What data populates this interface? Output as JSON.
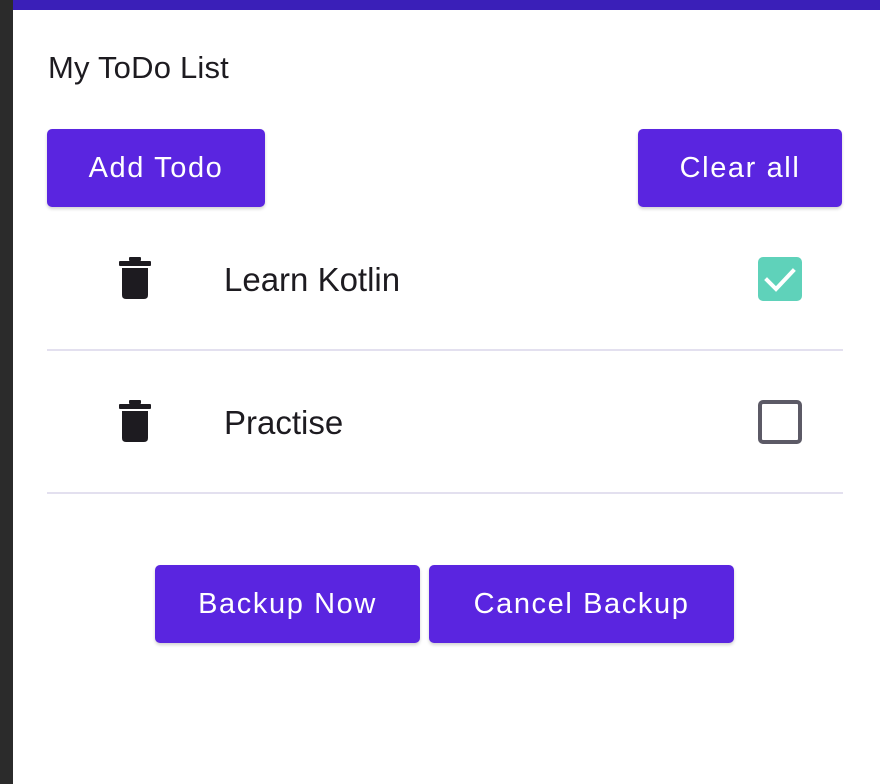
{
  "app": {
    "title": "My ToDo List"
  },
  "toolbar": {
    "add_label": "Add Todo",
    "clear_label": "Clear all"
  },
  "todos": [
    {
      "text": "Learn Kotlin",
      "done": true
    },
    {
      "text": "Practise",
      "done": false
    }
  ],
  "backup": {
    "backup_label": "Backup Now",
    "cancel_label": "Cancel Backup"
  },
  "colors": {
    "accent": "#5a25e0",
    "status_bar": "#3a1fb8",
    "checked": "#5fd2ba",
    "divider": "#e3e0ef"
  },
  "icons": {
    "delete": "trash-icon",
    "check": "check-icon"
  }
}
